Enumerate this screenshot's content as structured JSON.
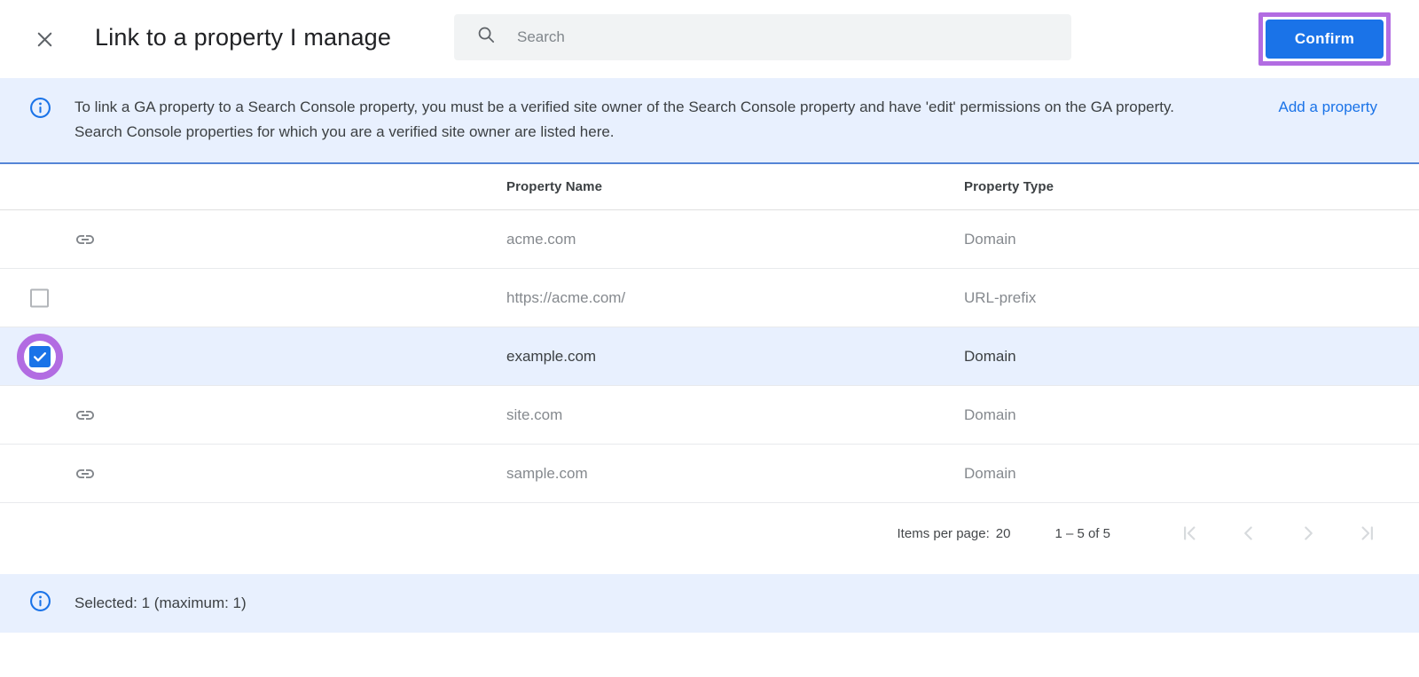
{
  "header": {
    "title": "Link to a property I manage",
    "search_placeholder": "Search",
    "confirm_label": "Confirm"
  },
  "info_banner": {
    "text": "To link a GA property to a Search Console property, you must be a verified site owner of the Search Console property and have 'edit' permissions on the GA property. Search Console properties for which you are a verified site owner are listed here.",
    "link_label": "Add a property"
  },
  "table": {
    "columns": [
      "Property Name",
      "Property Type"
    ],
    "rows": [
      {
        "name": "acme.com",
        "type": "Domain",
        "leading": "link-icon",
        "selected": false
      },
      {
        "name": "https://acme.com/",
        "type": "URL-prefix",
        "leading": "checkbox-unchecked",
        "selected": false
      },
      {
        "name": "example.com",
        "type": "Domain",
        "leading": "checkbox-checked",
        "selected": true,
        "annotated": true
      },
      {
        "name": "site.com",
        "type": "Domain",
        "leading": "link-icon",
        "selected": false
      },
      {
        "name": "sample.com",
        "type": "Domain",
        "leading": "link-icon",
        "selected": false
      }
    ]
  },
  "pagination": {
    "items_per_page_label": "Items per page:",
    "items_per_page_value": "20",
    "range_label": "1 – 5 of 5",
    "controls": [
      "first-page-icon",
      "previous-page-icon",
      "next-page-icon",
      "last-page-icon"
    ]
  },
  "footer_banner": {
    "text": "Selected: 1 (maximum: 1)"
  },
  "colors": {
    "accent_blue": "#1a73e8",
    "annotation_purple": "#b26ce2",
    "banner_bg": "#e8f0fe",
    "banner_border": "#5585d6",
    "selected_row_bg": "#e8f0fe",
    "search_bg": "#f1f3f4",
    "muted_text": "#85898e",
    "disabled_icon": "#d7dadd"
  }
}
